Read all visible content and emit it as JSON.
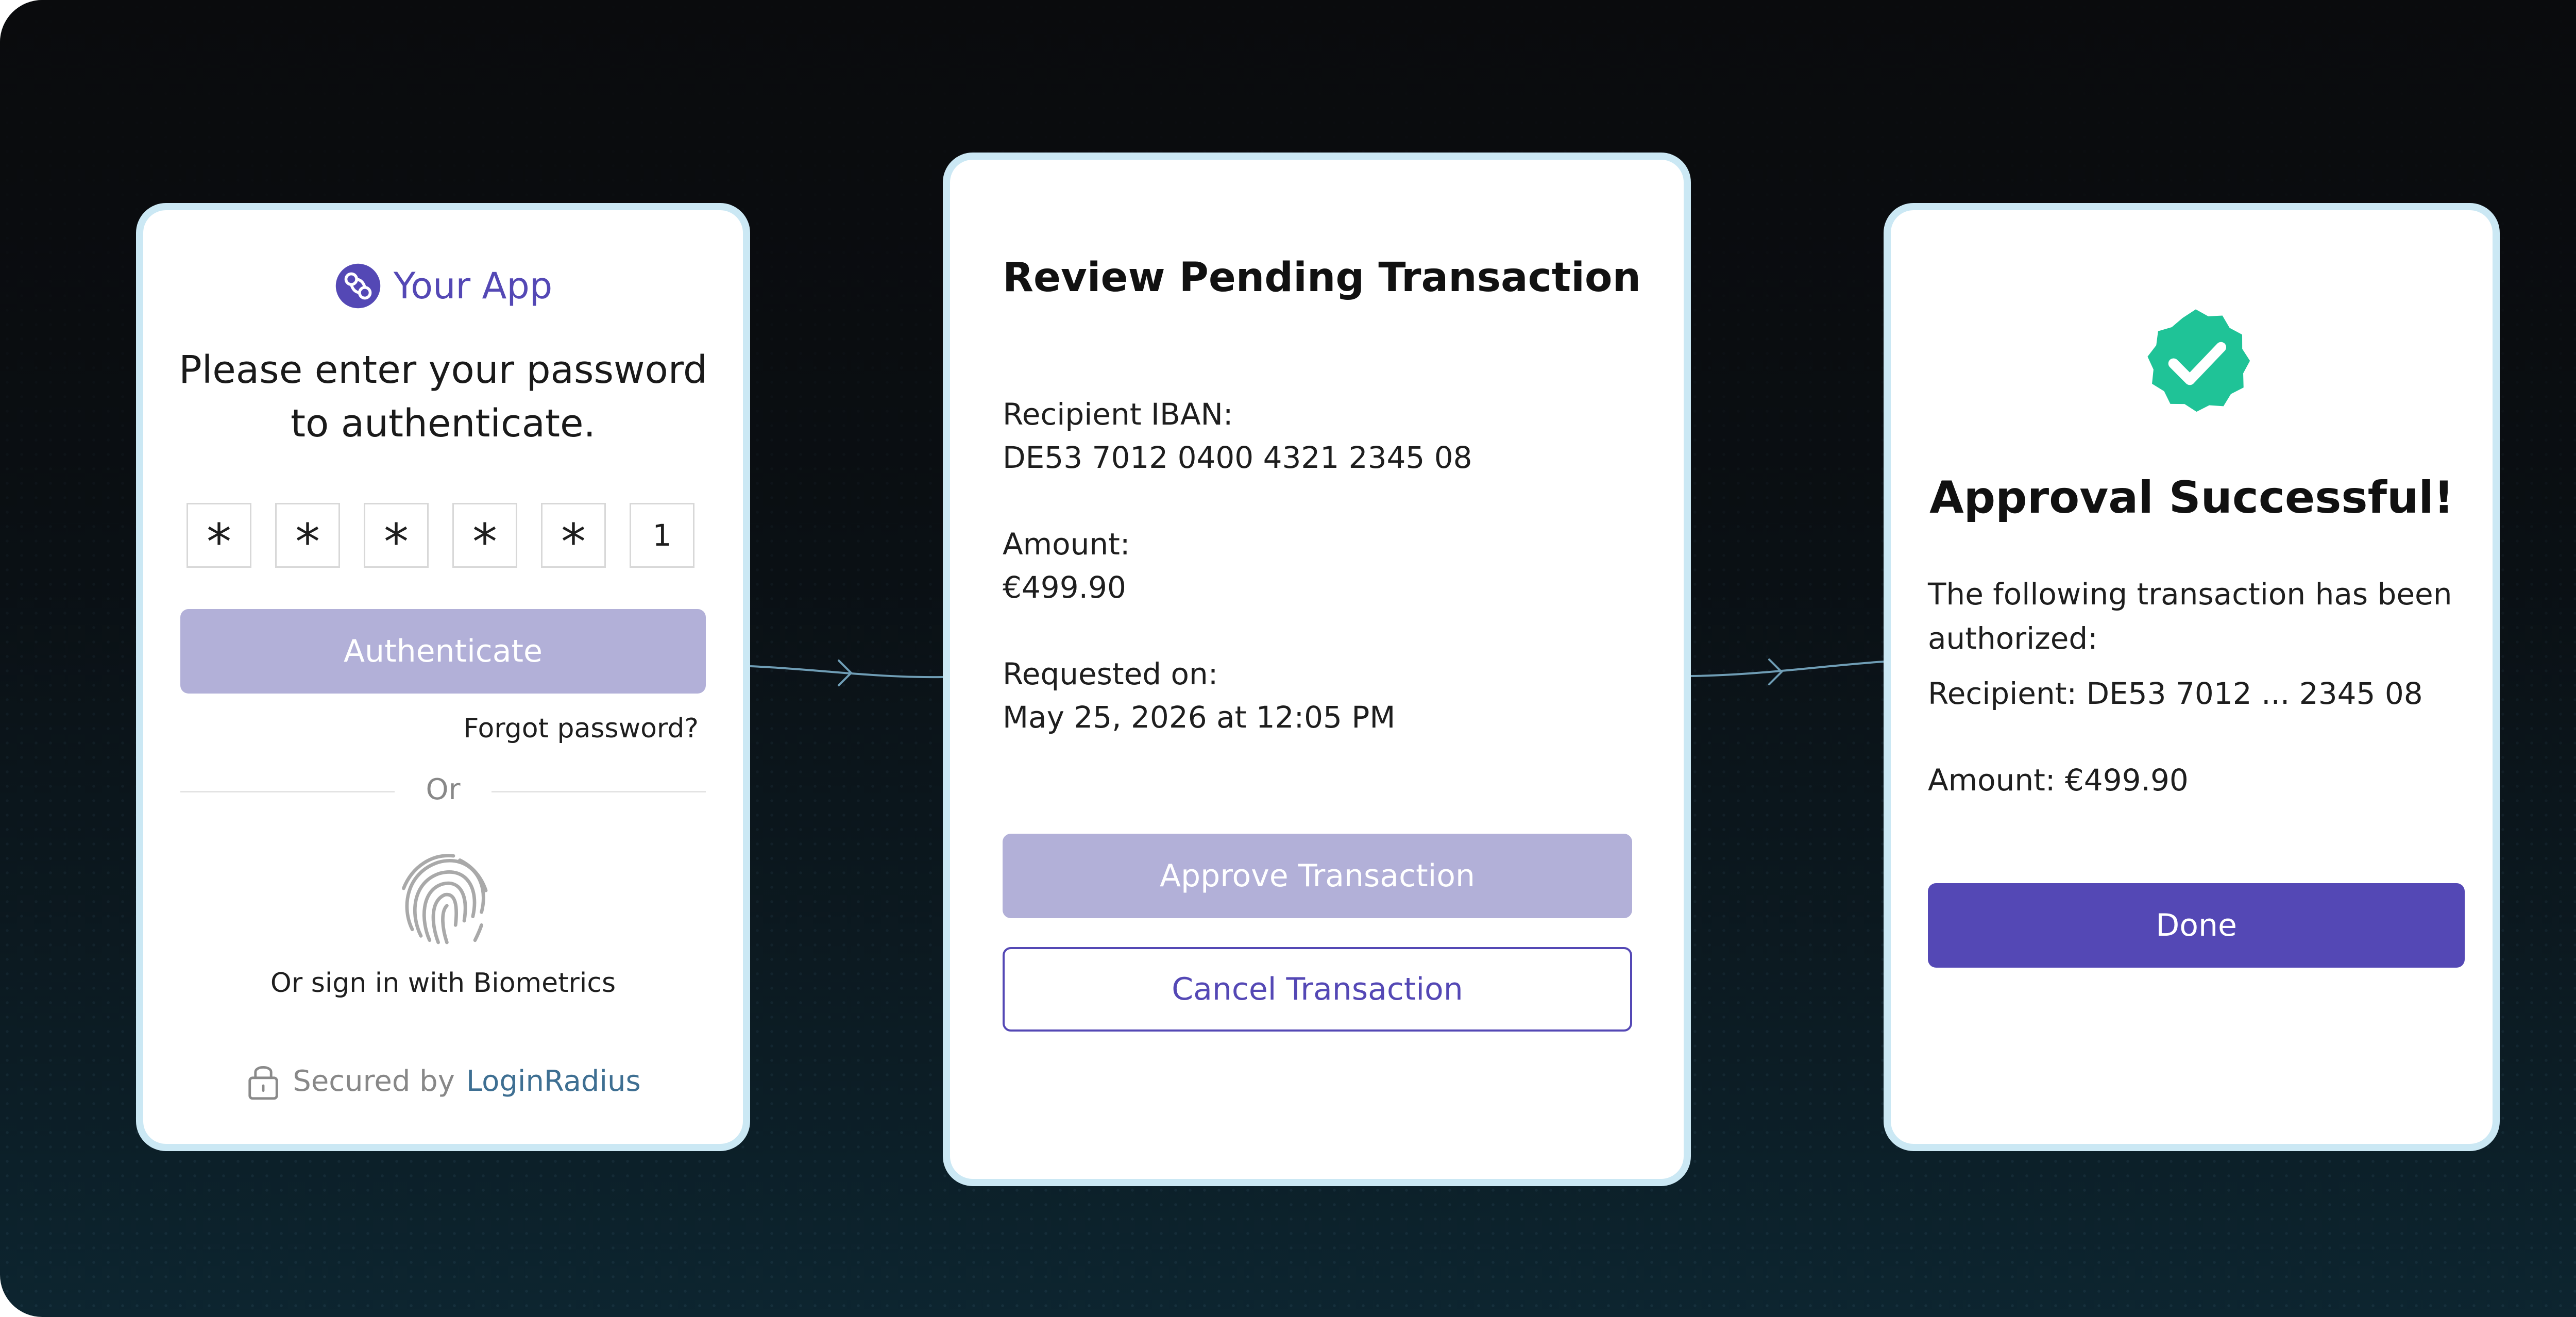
{
  "login_card": {
    "app_name": "Your App",
    "heading_line1": "Please enter your password",
    "heading_line2": "to authenticate.",
    "otp": [
      "*",
      "*",
      "*",
      "*",
      "*",
      "1"
    ],
    "authenticate_label": "Authenticate",
    "forgot_password": "Forgot password?",
    "or_text": "Or",
    "biometrics_label": "Or sign in with Biometrics",
    "secured_by": "Secured by",
    "secured_brand": "LoginRadius"
  },
  "review_card": {
    "title": "Review Pending Transaction",
    "recipient_label": "Recipient IBAN:",
    "recipient_value": "DE53 7012 0400 4321 2345 08",
    "amount_label": "Amount:",
    "amount_value": "€499.90",
    "requested_label": "Requested on:",
    "requested_value": "May 25, 2026 at 12:05 PM",
    "approve_label": "Approve Transaction",
    "cancel_label": "Cancel Transaction"
  },
  "success_card": {
    "title": "Approval Successful!",
    "description": "The following transaction has been authorized:",
    "recipient": "Recipient: DE53 7012 ... 2345 08",
    "amount": "Amount: €499.90",
    "done_label": "Done"
  },
  "colors": {
    "brand": "#5448b5",
    "button_muted": "#b2b0d8",
    "success": "#1fc397",
    "card_border": "#cbe8f4",
    "link": "#3e6f92"
  },
  "icons": {
    "app_logo": "app-logo-icon",
    "fingerprint": "fingerprint-icon",
    "lock": "lock-icon",
    "success_badge": "check-badge-icon",
    "connector_arrow": "arrow-right-icon"
  }
}
